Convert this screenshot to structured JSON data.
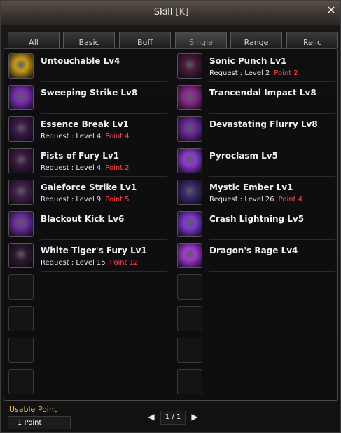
{
  "window": {
    "title": "Skill",
    "hotkey": "[K]",
    "close_glyph": "✕"
  },
  "tabs": [
    {
      "label": "All",
      "active": false
    },
    {
      "label": "Basic",
      "active": false
    },
    {
      "label": "Buff",
      "active": false
    },
    {
      "label": "Single",
      "active": true
    },
    {
      "label": "Range",
      "active": false
    },
    {
      "label": "Relic",
      "active": false
    }
  ],
  "skills": {
    "left": [
      {
        "name": "Untouchable Lv4",
        "request": "",
        "point": "",
        "icon": "yellow-aura-icon",
        "color": "#c89b1a"
      },
      {
        "name": "Sweeping Strike Lv8",
        "request": "",
        "point": "",
        "icon": "purple-slash-icon",
        "color": "#7a2fb0"
      },
      {
        "name": "Essence Break Lv1",
        "request": "Request : Level  4",
        "point": "Point  4",
        "icon": "dark-purple-icon",
        "color": "#3a1a4a"
      },
      {
        "name": "Fists of Fury Lv1",
        "request": "Request : Level  4",
        "point": "Point  2",
        "icon": "fists-icon",
        "color": "#3b1a40"
      },
      {
        "name": "Galeforce Strike Lv1",
        "request": "Request : Level  9",
        "point": "Point  5",
        "icon": "wind-strike-icon",
        "color": "#40204a"
      },
      {
        "name": "Blackout Kick Lv6",
        "request": "",
        "point": "",
        "icon": "kick-icon",
        "color": "#6a2fa0"
      },
      {
        "name": "White Tiger's Fury Lv1",
        "request": "Request : Level 15",
        "point": "Point 12",
        "icon": "tiger-icon",
        "color": "#2a1a30"
      },
      {
        "name": "",
        "request": "",
        "point": "",
        "icon": "empty-slot",
        "color": ""
      },
      {
        "name": "",
        "request": "",
        "point": "",
        "icon": "empty-slot",
        "color": ""
      },
      {
        "name": "",
        "request": "",
        "point": "",
        "icon": "empty-slot",
        "color": ""
      },
      {
        "name": "",
        "request": "",
        "point": "",
        "icon": "empty-slot",
        "color": ""
      }
    ],
    "right": [
      {
        "name": "Sonic Punch Lv1",
        "request": "Request : Level  2",
        "point": "Point  2",
        "icon": "punch-icon",
        "color": "#4a1a3a"
      },
      {
        "name": "Trancendal Impact Lv8",
        "request": "",
        "point": "",
        "icon": "impact-icon",
        "color": "#8a2a8a"
      },
      {
        "name": "Devastating Flurry Lv8",
        "request": "",
        "point": "",
        "icon": "flurry-icon",
        "color": "#6a2a9a"
      },
      {
        "name": "Pyroclasm Lv5",
        "request": "",
        "point": "",
        "icon": "pyroclasm-icon",
        "color": "#8a3ad0"
      },
      {
        "name": "Mystic Ember Lv1",
        "request": "Request : Level 26",
        "point": "Point  4",
        "icon": "ember-icon",
        "color": "#3a2a6a"
      },
      {
        "name": "Crash Lightning Lv5",
        "request": "",
        "point": "",
        "icon": "lightning-icon",
        "color": "#7a3ad0"
      },
      {
        "name": "Dragon's Rage Lv4",
        "request": "",
        "point": "",
        "icon": "dragon-icon",
        "color": "#a03ad0"
      },
      {
        "name": "",
        "request": "",
        "point": "",
        "icon": "empty-slot",
        "color": ""
      },
      {
        "name": "",
        "request": "",
        "point": "",
        "icon": "empty-slot",
        "color": ""
      },
      {
        "name": "",
        "request": "",
        "point": "",
        "icon": "empty-slot",
        "color": ""
      },
      {
        "name": "",
        "request": "",
        "point": "",
        "icon": "empty-slot",
        "color": ""
      }
    ]
  },
  "footer": {
    "usable_label": "Usable Point",
    "usable_value": "1 Point",
    "page": "1 / 1",
    "prev_glyph": "◀",
    "next_glyph": "▶"
  }
}
